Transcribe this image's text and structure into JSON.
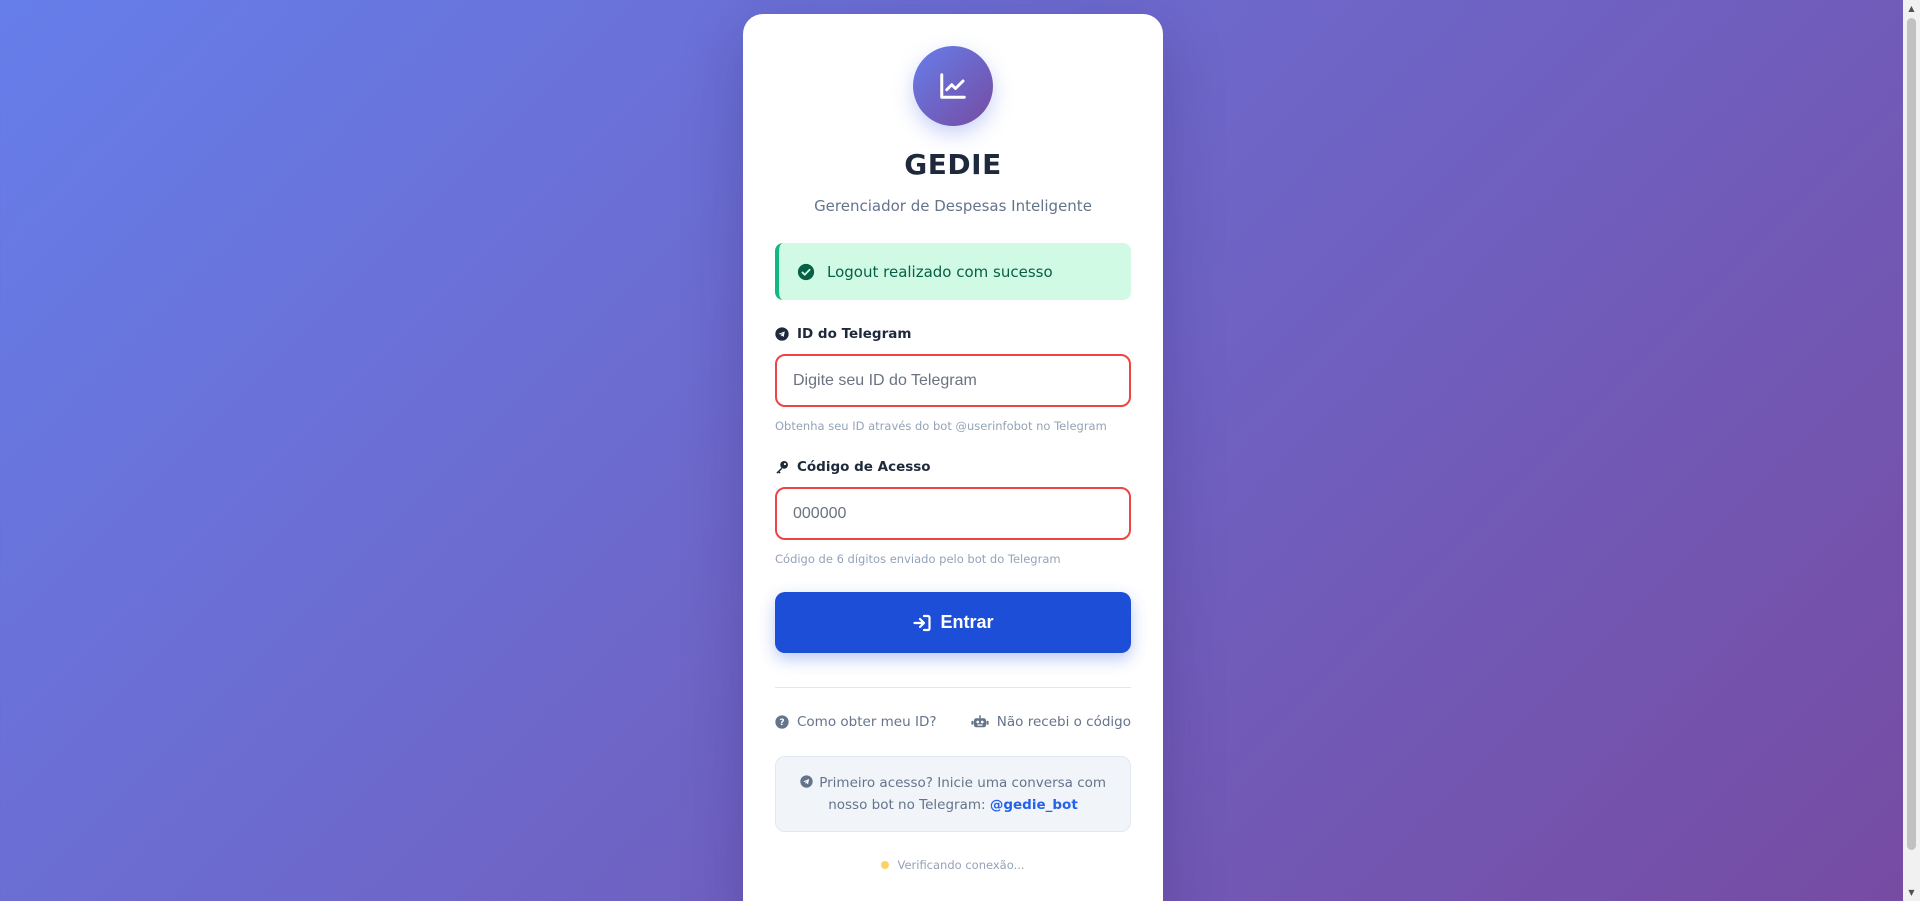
{
  "app": {
    "title": "GEDIE",
    "subtitle": "Gerenciador de Despesas Inteligente"
  },
  "alert": {
    "message": "Logout realizado com sucesso",
    "color": "#10b981"
  },
  "form": {
    "telegram": {
      "label": "ID do Telegram",
      "placeholder": "Digite seu ID do Telegram",
      "value": "",
      "hint": "Obtenha seu ID através do bot @userinfobot no Telegram"
    },
    "code": {
      "label": "Código de Acesso",
      "placeholder": "000000",
      "value": "",
      "hint": "Código de 6 dígitos enviado pelo bot do Telegram"
    },
    "submit_label": "Entrar"
  },
  "links": {
    "how_id": "Como obter meu ID?",
    "no_code": "Não recebi o código"
  },
  "info": {
    "text": "Primeiro acesso? Inicie uma conversa com nosso bot no Telegram:",
    "bot_handle": "@gedie_bot"
  },
  "status": {
    "text": "Verificando conexão...",
    "dot_color": "#fbbf24"
  },
  "colors": {
    "accent": "#1d4ed8",
    "gradient_start": "#667eea",
    "gradient_end": "#764ba2",
    "error_border": "#ef4444"
  }
}
